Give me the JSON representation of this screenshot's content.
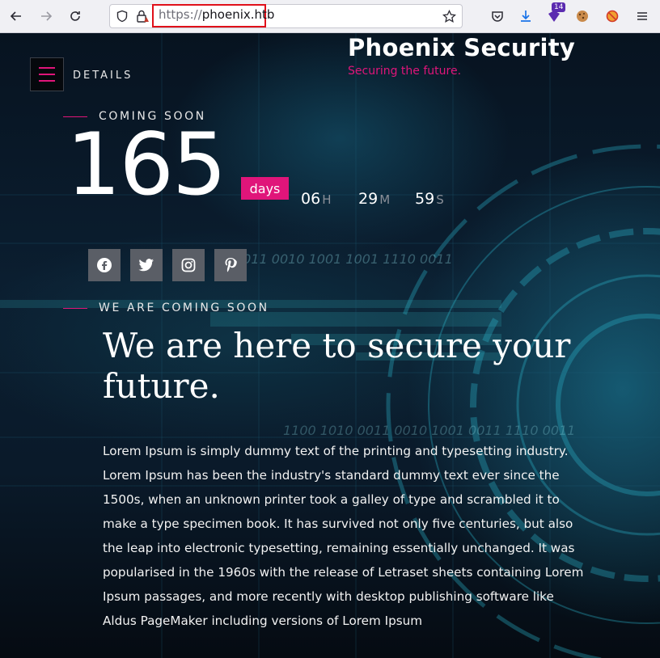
{
  "browser": {
    "url_scheme": "https://",
    "url_host": "phoenix.htb",
    "extension_badge": "14"
  },
  "site": {
    "menu_label": "DETAILS",
    "brand_title": "Phoenix Security",
    "brand_tagline": "Securing the future.",
    "coming_soon_label": "COMING SOON",
    "countdown": {
      "days": "165",
      "days_label": "days",
      "hours": "06",
      "hours_label": "H",
      "minutes": "29",
      "minutes_label": "M",
      "seconds": "59",
      "seconds_label": "S"
    },
    "social": [
      "facebook-icon",
      "twitter-icon",
      "instagram-icon",
      "pinterest-icon"
    ],
    "section_label": "WE ARE COMING SOON",
    "headline": "We are here to secure your future.",
    "paragraph": "Lorem Ipsum is simply dummy text of the printing and typesetting industry. Lorem Ipsum has been the industry's standard dummy text ever since the 1500s, when an unknown printer took a galley of type and scrambled it to make a type specimen book. It has survived not only five centuries, but also the leap into electronic typesetting, remaining essentially unchanged. It was popularised in the 1960s with the release of Letraset sheets containing Lorem Ipsum passages, and more recently with desktop publishing software like Aldus PageMaker including versions of Lorem Ipsum",
    "accent_color": "#e0157a",
    "deco_binary_1": "0011 0010 1001 1001 1110 0011",
    "deco_binary_2": "1100 1010 0011 0010 1001 0011 1110 0011"
  }
}
